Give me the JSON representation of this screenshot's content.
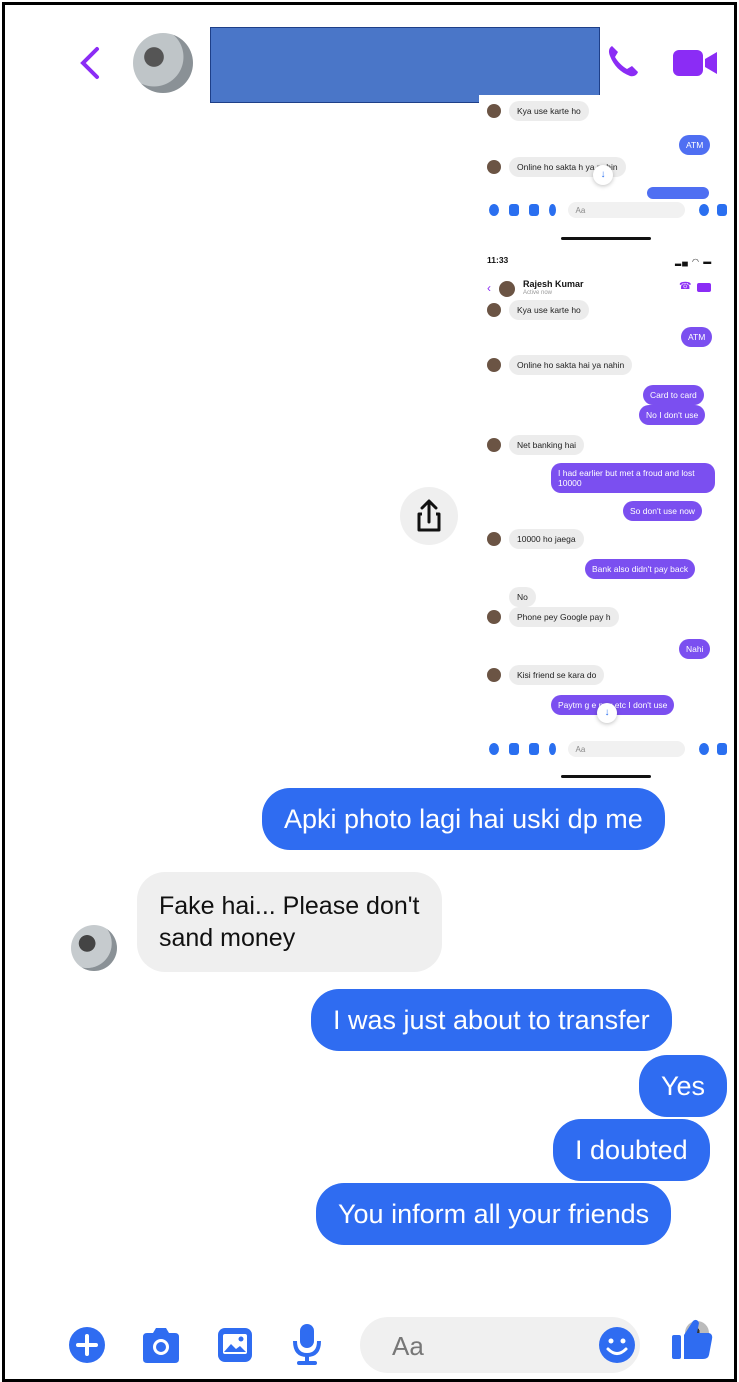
{
  "header": {
    "contact_name": "",
    "back_icon": "chevron-left-icon",
    "call_icon": "phone-icon",
    "video_icon": "video-icon",
    "accent": "#8b2cf5"
  },
  "embedded": {
    "top_fragment": {
      "incoming_1": "Kya use karte ho",
      "outgoing_1": "ATM",
      "incoming_2": "Online ho sakta h  ya nahin",
      "input_placeholder": "Aa"
    },
    "second": {
      "time": "11:33",
      "name": "Rajesh Kumar",
      "status": "Active now",
      "messages": [
        {
          "dir": "in",
          "text": "Kya use karte ho"
        },
        {
          "dir": "out",
          "text": "ATM"
        },
        {
          "dir": "in",
          "text": "Online ho sakta hai ya nahin"
        },
        {
          "dir": "out",
          "text": "Card to card"
        },
        {
          "dir": "out",
          "text": "No I don't use"
        },
        {
          "dir": "in",
          "text": "Net banking hai"
        },
        {
          "dir": "out",
          "text": "I had earlier but met a froud and lost 10000"
        },
        {
          "dir": "out",
          "text": "So don't use now"
        },
        {
          "dir": "in",
          "text": "10000 ho jaega"
        },
        {
          "dir": "out",
          "text": "Bank also didn't pay back"
        },
        {
          "dir": "in",
          "text": "No"
        },
        {
          "dir": "in",
          "text": "Phone pey Google pay h"
        },
        {
          "dir": "out",
          "text": "Nahi"
        },
        {
          "dir": "in",
          "text": "Kisi friend se kara do"
        },
        {
          "dir": "out",
          "text": "Paytm g   e pay etc I don't use"
        }
      ],
      "input_placeholder": "Aa"
    }
  },
  "messages": {
    "out_1": "Apki photo lagi hai uski dp me",
    "in_1": "Fake hai... Please don't\nsand money",
    "out_2": "I was just about to transfer",
    "out_3": "Yes",
    "out_4": "I doubted",
    "out_5": "You inform all your friends"
  },
  "composer": {
    "placeholder": "Aa",
    "icons": [
      "plus-icon",
      "camera-icon",
      "image-icon",
      "microphone-icon",
      "emoji-icon",
      "thumbs-up-icon"
    ],
    "color": "#2f6cf1"
  }
}
